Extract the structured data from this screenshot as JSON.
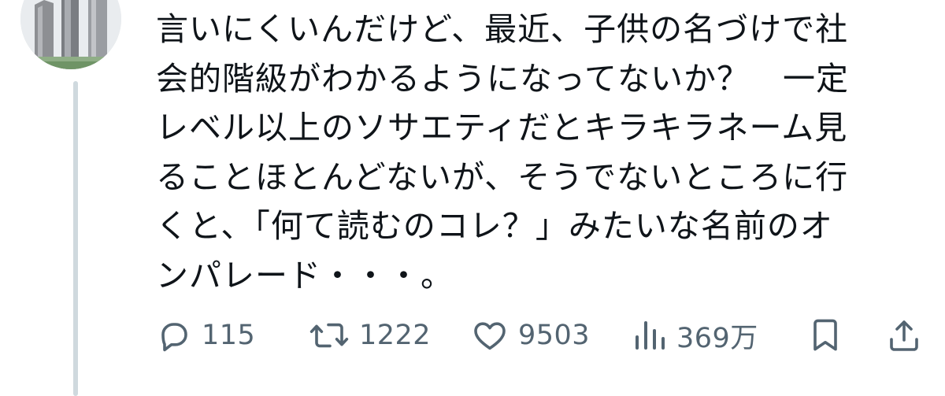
{
  "tweet": {
    "lines": [
      "言いにくいんだけど、最近、子供の名づけで社",
      "会的階級がわかるようになってないか？　一定",
      "レベル以上のソサエティだとキラキラネーム見",
      "ることほとんどないが、そうでないところに行",
      "くと、「何て読むのコレ？」みたいな名前のオ",
      "ンパレード・・・。"
    ]
  },
  "actions": {
    "reply_count": "115",
    "retweet_count": "1222",
    "like_count": "9503",
    "views_count": "369万"
  },
  "icons": {
    "reply": "reply-icon",
    "retweet": "retweet-icon",
    "like": "heart-icon",
    "views": "views-icon",
    "bookmark": "bookmark-icon",
    "share": "share-icon"
  },
  "colors": {
    "text": "#0f1419",
    "secondary": "#536471",
    "thread_line": "#cfd9de"
  }
}
